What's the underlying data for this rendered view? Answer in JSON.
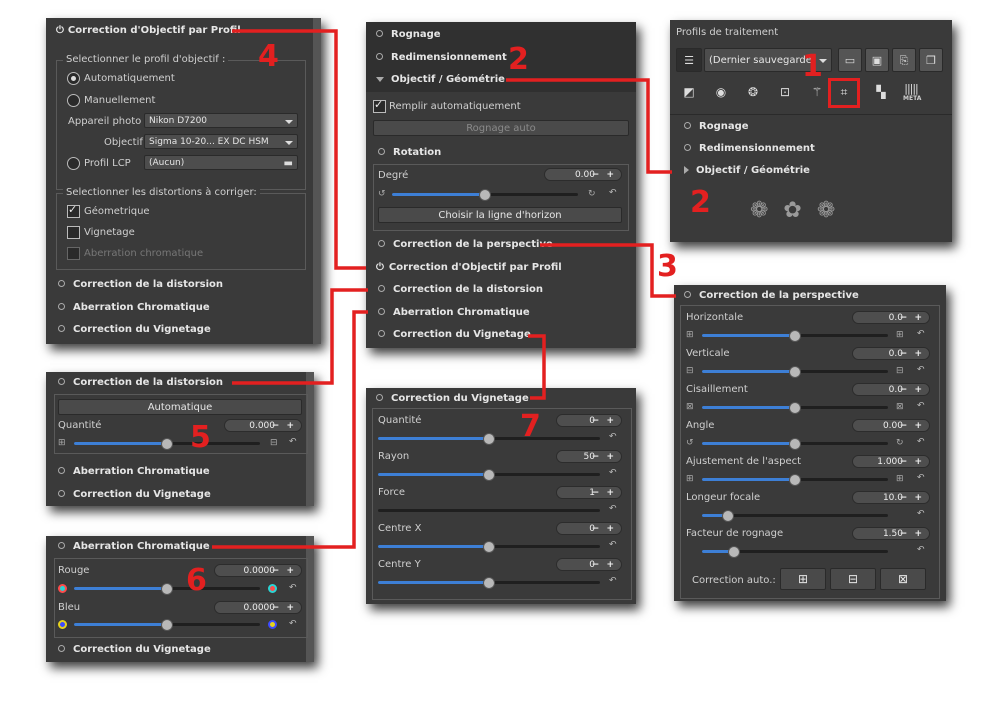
{
  "profile": {
    "title": "Correction d'Objectif par Profil",
    "group1_title": "Selectionner le profil d'objectif :",
    "auto_label": "Automatiquement",
    "manual_label": "Manuellement",
    "camera_label": "Appareil photo",
    "camera_value": "Nikon D7200",
    "lens_label": "Objectif",
    "lens_value": "Sigma 10-20... EX DC HSM",
    "lcp_label": "Profil LCP",
    "lcp_value": "(Aucun)",
    "group2_title": "Selectionner les distortions à corriger:",
    "geo_label": "Géometrique",
    "vig_label": "Vignetage",
    "ca_label": "Aberration chromatique",
    "footer": [
      "Correction de la distorsion",
      "Aberration Chromatique",
      "Correction du Vignetage"
    ],
    "number": "4"
  },
  "main": {
    "crop": "Rognage",
    "resize": "Redimensionnement",
    "lens_geo": "Objectif / Géométrie",
    "autofill": "Remplir automatiquement",
    "autocrop": "Rognage auto",
    "rotation": "Rotation",
    "degree_label": "Degré",
    "degree_value": "0.00",
    "horizon_btn": "Choisir la ligne d'horizon",
    "perspective": "Correction de la perspective",
    "lens_profile": "Correction d'Objectif par Profil",
    "distortion": "Correction de la distorsion",
    "ca": "Aberration Chromatique",
    "vignetting": "Correction du Vignetage",
    "number": "2"
  },
  "profiles": {
    "title": "Profils de traitement",
    "combo": "(Dernier sauvegardé)",
    "items": [
      "Rognage",
      "Redimensionnement",
      "Objectif / Géométrie"
    ],
    "tab_meta": "META",
    "number1": "1",
    "number2": "2",
    "ornament": "❁ ✿ ❁"
  },
  "perspective": {
    "title": "Correction de la perspective",
    "rows": [
      {
        "label": "Horizontale",
        "value": "0.0",
        "level": 0.5
      },
      {
        "label": "Verticale",
        "value": "0.0",
        "level": 0.5
      },
      {
        "label": "Cisaillement",
        "value": "0.0",
        "level": 0.5
      },
      {
        "label": "Angle",
        "value": "0.00",
        "level": 0.5
      },
      {
        "label": "Ajustement de l'aspect",
        "value": "1.000",
        "level": 0.5
      },
      {
        "label": "Longeur focale",
        "value": "10.0",
        "level": 0.14
      },
      {
        "label": "Facteur de rognage",
        "value": "1.50",
        "level": 0.17
      }
    ],
    "auto_label": "Correction auto.:",
    "number": "3"
  },
  "distortion": {
    "title": "Correction de la distorsion",
    "auto_btn": "Automatique",
    "qty_label": "Quantité",
    "qty_value": "0.000",
    "qty_level": 0.5,
    "footer": [
      "Aberration Chromatique",
      "Correction du Vignetage"
    ],
    "number": "5"
  },
  "chromatic": {
    "title": "Aberration Chromatique",
    "red_label": "Rouge",
    "red_value": "0.0000",
    "blue_label": "Bleu",
    "blue_value": "0.0000",
    "level": 0.5,
    "footer": "Correction du Vignetage",
    "number": "6",
    "red_color": "#ff4b4b",
    "cyan_color": "#2ad4d4",
    "blue_color": "#3d4bff",
    "yellow_color": "#e6d21e"
  },
  "vignetting": {
    "title": "Correction du Vignetage",
    "rows": [
      {
        "label": "Quantité",
        "value": "0",
        "level": 0.5
      },
      {
        "label": "Rayon",
        "value": "50",
        "level": 0.5
      },
      {
        "label": "Force",
        "value": "1",
        "level": 0.0
      },
      {
        "label": "Centre X",
        "value": "0",
        "level": 0.5
      },
      {
        "label": "Centre Y",
        "value": "0",
        "level": 0.5
      }
    ],
    "number": "7"
  },
  "colors": {
    "annotation_red": "#e32020",
    "slider_blue": "#3d7fd6",
    "panel_bg": "#3a3a3a"
  }
}
